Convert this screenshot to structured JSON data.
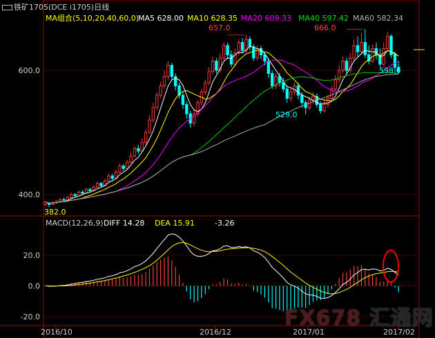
{
  "header": {
    "title": "铁矿1705(DCE i1705)日线",
    "ma_group_label": "MA组合(5,10,20,40,60,0)",
    "ma5": "MA5  628.00",
    "ma10": "MA10  628.35",
    "ma20": "MA20  609.33",
    "ma40": "MA40  597.42",
    "ma60": "MA60  582.34"
  },
  "macd_header": {
    "label": "MACD(12,26,9)",
    "diff": "DIFF   14.28",
    "dea": "DEA   15.91",
    "macd": "-3.26"
  },
  "annotations": {
    "high1": "657.0",
    "high2": "666.0",
    "low1": "529.0",
    "last": "598.0",
    "start": "382.0"
  },
  "watermark": {
    "brand": "FX678",
    "cn": "汇通网"
  },
  "colors": {
    "up": "#ff3b3b",
    "down": "#00ffff",
    "ma5": "#ffffff",
    "ma10": "#ffff00",
    "ma20": "#ff00ff",
    "ma40": "#00cc00",
    "ma60": "#aaaaaa",
    "grid": "#7a0000",
    "axis": "#aa0000",
    "circle": "#ff0000"
  },
  "chart_data": [
    {
      "type": "candlestick",
      "title": "铁矿1705(DCE i1705)日线",
      "x_labels": [
        "2016/10",
        "2016/12",
        "2017/01",
        "2017/02"
      ],
      "y_ticks": [
        400.0,
        600.0
      ],
      "ylim": [
        380,
        680
      ],
      "candles": [
        [
          384,
          388,
          381,
          386
        ],
        [
          386,
          384,
          380,
          388
        ],
        [
          384,
          387,
          383,
          389
        ],
        [
          387,
          389,
          385,
          391
        ],
        [
          389,
          392,
          387,
          394
        ],
        [
          392,
          391,
          388,
          395
        ],
        [
          391,
          395,
          390,
          398
        ],
        [
          395,
          400,
          394,
          403
        ],
        [
          400,
          398,
          395,
          402
        ],
        [
          398,
          404,
          397,
          406
        ],
        [
          404,
          402,
          400,
          407
        ],
        [
          402,
          408,
          401,
          411
        ],
        [
          408,
          406,
          403,
          411
        ],
        [
          406,
          412,
          405,
          415
        ],
        [
          412,
          418,
          410,
          421
        ],
        [
          418,
          414,
          411,
          420
        ],
        [
          414,
          422,
          413,
          425
        ],
        [
          422,
          430,
          420,
          434
        ],
        [
          430,
          426,
          423,
          433
        ],
        [
          426,
          436,
          425,
          440
        ],
        [
          436,
          446,
          434,
          450
        ],
        [
          446,
          442,
          438,
          449
        ],
        [
          442,
          452,
          440,
          456
        ],
        [
          452,
          462,
          450,
          468
        ],
        [
          462,
          474,
          460,
          478
        ],
        [
          474,
          470,
          465,
          480
        ],
        [
          470,
          484,
          468,
          490
        ],
        [
          484,
          500,
          480,
          505
        ],
        [
          500,
          520,
          498,
          528
        ],
        [
          520,
          540,
          516,
          548
        ],
        [
          540,
          560,
          536,
          565
        ],
        [
          560,
          575,
          555,
          582
        ],
        [
          575,
          590,
          570,
          600
        ],
        [
          590,
          608,
          585,
          615
        ],
        [
          608,
          590,
          585,
          612
        ],
        [
          590,
          575,
          568,
          595
        ],
        [
          575,
          560,
          555,
          580
        ],
        [
          560,
          545,
          538,
          565
        ],
        [
          545,
          530,
          522,
          550
        ],
        [
          530,
          515,
          508,
          535
        ],
        [
          515,
          530,
          510,
          538
        ],
        [
          530,
          548,
          526,
          552
        ],
        [
          548,
          565,
          544,
          570
        ],
        [
          565,
          580,
          560,
          585
        ],
        [
          580,
          598,
          576,
          605
        ],
        [
          598,
          615,
          594,
          622
        ],
        [
          615,
          600,
          595,
          620
        ],
        [
          600,
          620,
          596,
          628
        ],
        [
          620,
          640,
          615,
          645
        ],
        [
          640,
          625,
          618,
          645
        ],
        [
          625,
          610,
          605,
          632
        ],
        [
          610,
          628,
          606,
          635
        ],
        [
          628,
          645,
          624,
          650
        ],
        [
          645,
          632,
          628,
          652
        ],
        [
          632,
          650,
          628,
          657
        ],
        [
          650,
          638,
          632,
          655
        ],
        [
          638,
          620,
          615,
          642
        ],
        [
          620,
          635,
          616,
          640
        ],
        [
          635,
          625,
          618,
          640
        ],
        [
          625,
          615,
          608,
          630
        ],
        [
          615,
          595,
          588,
          620
        ],
        [
          595,
          575,
          570,
          600
        ],
        [
          575,
          590,
          570,
          595
        ],
        [
          590,
          580,
          574,
          596
        ],
        [
          580,
          570,
          565,
          588
        ],
        [
          570,
          555,
          548,
          575
        ],
        [
          555,
          565,
          550,
          572
        ],
        [
          565,
          575,
          560,
          580
        ],
        [
          575,
          560,
          553,
          580
        ],
        [
          560,
          548,
          540,
          565
        ],
        [
          548,
          540,
          529,
          552
        ],
        [
          540,
          552,
          536,
          558
        ],
        [
          552,
          558,
          546,
          565
        ],
        [
          558,
          545,
          540,
          563
        ],
        [
          545,
          535,
          530,
          550
        ],
        [
          535,
          545,
          532,
          552
        ],
        [
          545,
          555,
          540,
          560
        ],
        [
          555,
          570,
          552,
          575
        ],
        [
          570,
          585,
          566,
          592
        ],
        [
          585,
          600,
          580,
          608
        ],
        [
          600,
          615,
          596,
          622
        ],
        [
          615,
          600,
          594,
          620
        ],
        [
          600,
          620,
          596,
          628
        ],
        [
          620,
          640,
          615,
          650
        ],
        [
          640,
          630,
          622,
          655
        ],
        [
          630,
          645,
          626,
          660
        ],
        [
          645,
          625,
          620,
          666
        ],
        [
          625,
          615,
          610,
          640
        ],
        [
          615,
          635,
          612,
          642
        ],
        [
          635,
          625,
          618,
          645
        ],
        [
          625,
          610,
          605,
          635
        ],
        [
          610,
          635,
          606,
          645
        ],
        [
          635,
          655,
          630,
          662
        ],
        [
          655,
          625,
          620,
          658
        ],
        [
          625,
          605,
          598,
          630
        ],
        [
          605,
          598,
          595,
          615
        ]
      ],
      "ma_series": [
        {
          "name": "MA5",
          "values": [
            600,
            590,
            618,
            632,
            628
          ]
        },
        {
          "name": "MA10",
          "values": [
            605,
            600,
            612,
            630,
            628
          ]
        },
        {
          "name": "MA20",
          "values": [
            590,
            598,
            600,
            615,
            609
          ]
        },
        {
          "name": "MA40",
          "values": [
            560,
            575,
            590,
            598,
            597
          ]
        },
        {
          "name": "MA60",
          "values": [
            540,
            560,
            575,
            583,
            582
          ]
        }
      ]
    },
    {
      "type": "bar_line",
      "title": "MACD(12,26,9)",
      "y_ticks": [
        20.0,
        0.0,
        -20.0
      ],
      "ylim": [
        -25,
        38
      ],
      "series": [
        {
          "name": "DIFF",
          "values": [
            14.28
          ]
        },
        {
          "name": "DEA",
          "values": [
            15.91
          ]
        },
        {
          "name": "MACD",
          "values": [
            -3.26
          ]
        }
      ]
    }
  ]
}
